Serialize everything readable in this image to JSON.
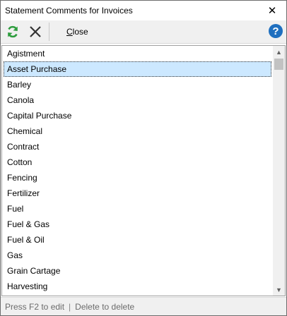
{
  "window": {
    "title": "Statement Comments for Invoices",
    "close_glyph": "✕"
  },
  "toolbar": {
    "refresh_icon": "refresh-icon",
    "delete_icon": "delete-x-icon",
    "close_label_prefix": "C",
    "close_label_rest": "lose",
    "help_icon": "help-icon",
    "accent_green": "#2e9d3e",
    "accent_blue": "#1f6fbf"
  },
  "list": {
    "items": [
      "Agistment",
      "Asset Purchase",
      "Barley",
      "Canola",
      "Capital Purchase",
      "Chemical",
      "Contract",
      "Cotton",
      "Fencing",
      "Fertilizer",
      "Fuel",
      "Fuel & Gas",
      "Fuel & Oil",
      "Gas",
      "Grain Cartage",
      "Harvesting"
    ],
    "selected_item": "Asset Purchase"
  },
  "statusbar": {
    "left": "Press F2 to edit",
    "separator": "|",
    "right": "Delete to delete"
  }
}
